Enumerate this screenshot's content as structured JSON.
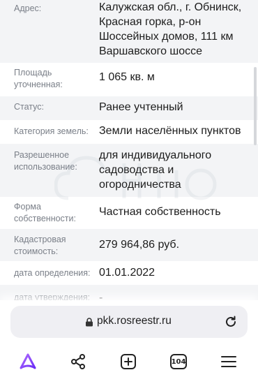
{
  "details": {
    "address": {
      "label": "Адрес:",
      "value": "Калужская обл., г. Обнинск, Красная горка, р-он Шоссейных домов, 111 км Варшавского шоссе"
    },
    "area": {
      "label": "Площадь уточненная:",
      "value": "1 065 кв. м"
    },
    "status": {
      "label": "Статус:",
      "value": "Ранее учтенный"
    },
    "land_category": {
      "label": "Категория земель:",
      "value": "Земли населённых пунктов"
    },
    "permitted_use": {
      "label": "Разрешенное использование:",
      "value": "для индивидуального садоводства и огородничества"
    },
    "ownership": {
      "label": "Форма собственности:",
      "value": "Частная собственность"
    },
    "cadastral_value": {
      "label": "Кадастровая стоимость:",
      "value": "279 964,86 руб."
    },
    "determination_date": {
      "label": "дата определения:",
      "value": "01.01.2022"
    },
    "approval_date": {
      "label": "дата утверждения:",
      "value": "-"
    }
  },
  "browser": {
    "url": "pkk.rosreestr.ru",
    "tabs_count": "104",
    "icons": [
      "lock-icon",
      "reload-icon",
      "alice-icon",
      "share-icon",
      "new-tab-icon",
      "tabs-icon",
      "menu-icon"
    ],
    "accent_color": "#8a3ffc"
  }
}
